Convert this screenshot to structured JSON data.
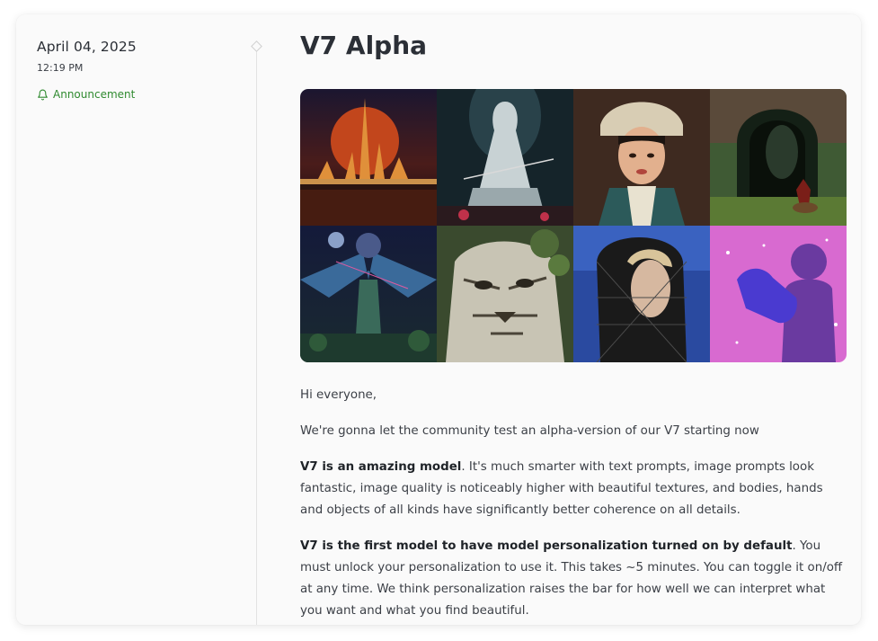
{
  "post": {
    "date": "April 04, 2025",
    "time": "12:19 PM",
    "tag": "Announcement",
    "title": "V7 Alpha",
    "paragraphs": {
      "p1": "Hi everyone,",
      "p2": "We're gonna let the community test an alpha-version of our V7 starting now",
      "p3_bold": "V7 is an amazing model",
      "p3_rest": ". It's much smarter with text prompts, image prompts look fantastic, image quality is noticeably higher with beautiful textures, and bodies, hands and objects of all kinds have significantly better coherence on all details.",
      "p4_bold": "V7 is the first model to have model personalization turned on by default",
      "p4_rest": ". You must unlock your personalization to use it. This takes ~5 minutes. You can toggle it on/off at any time. We think personalization raises the bar for how well we can interpret what you want and what you find beautiful."
    }
  },
  "icons": {
    "tag_icon": "bell-icon",
    "timeline_marker": "diamond-icon"
  },
  "colors": {
    "tag": "#2f8a2f",
    "card_bg": "#fafafa",
    "title": "#2b2f36"
  }
}
